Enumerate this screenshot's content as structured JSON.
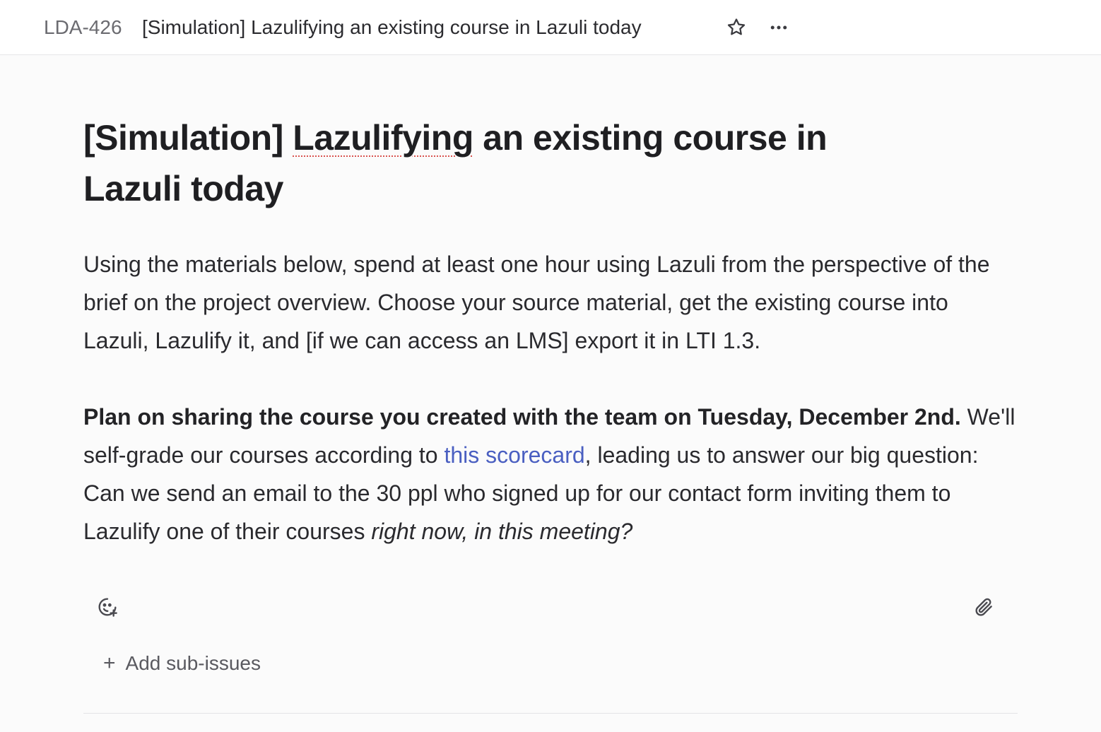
{
  "header": {
    "issue_id": "LDA-426",
    "issue_title": "[Simulation] Lazulifying an existing course in Lazuli today",
    "star_icon": "star-icon",
    "more_icon": "more-icon"
  },
  "issue": {
    "title_part1": "[Simulation] ",
    "title_squiggle": "Lazulifying",
    "title_part2": " an existing course in Lazuli today",
    "paragraph1": "Using the materials below, spend at least one hour using Lazuli from the perspective of the brief on the project overview. Choose your source material, get the existing course into Lazuli, Lazulify it, and [if we can access an LMS] export it in LTI 1.3.",
    "paragraph2_bold": "Plan on sharing the course you created with the team on Tuesday, December 2nd.",
    "paragraph2_pre_link": " We'll self-grade our courses according to ",
    "paragraph2_link": "this scorecard",
    "paragraph2_post_link": ", leading us to answer our big question: Can we send an email to the 30 ppl who signed up for our contact form inviting them to Lazulify one of their courses ",
    "paragraph2_italic": "right now, in this meeting?"
  },
  "actions": {
    "reaction_icon": "add-reaction-icon",
    "attach_icon": "paperclip-icon",
    "add_subissues_plus": "+",
    "add_subissues_label": "Add sub-issues"
  },
  "colors": {
    "link": "#4a5fc1",
    "spellcheck_underline": "#d9534f"
  }
}
